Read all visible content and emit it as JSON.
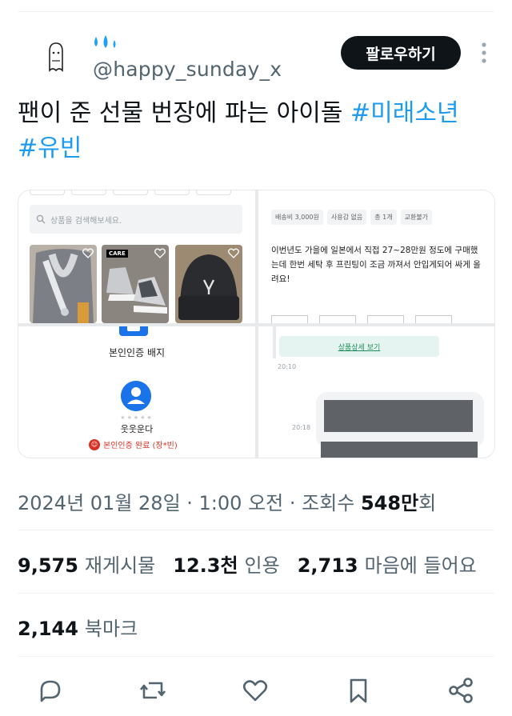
{
  "author": {
    "handle": "@happy_sunday_x",
    "avatar_icon": "ghost-doodle-icon",
    "header_icon": "water-drops-icon",
    "follow_label": "팔로우하기",
    "more_icon": "more-vertical-icon"
  },
  "tweet": {
    "text": "팬이 준 선물 번장에 파는 아이돌 ",
    "hashtags": [
      "#미래소년",
      "#유빈"
    ]
  },
  "media": {
    "search_placeholder": "상품을 검색해보세요.",
    "care_tag": "CARE",
    "chips": [
      "배송비 3,000원",
      "사용감 없음",
      "총 1개",
      "교환불가"
    ],
    "description": "이번년도 가을에 일본에서 직접 27~28만원 정도에 구매했는데 한번 세탁 후 프린팅이 조금 까져서 안입게되어 싸게 올려요!",
    "badge_title": "본인인증 배지",
    "nickname": "웃웃운다",
    "verified_text": "본인인증 완료 (장*빈)",
    "detail_button": "상품상세 보기",
    "time_1": "20:10",
    "time_2": "20:18"
  },
  "meta": {
    "datetime": "2024년 01월 28일 · 1:00 오전 · 조회수 ",
    "views_number": "548만",
    "views_suffix": "회"
  },
  "stats": {
    "retweets": "9,575",
    "retweets_label": "재게시물",
    "quotes": "12.3천",
    "quotes_label": "인용",
    "likes": "2,713",
    "likes_label": "마음에 들어요",
    "bookmarks": "2,144",
    "bookmarks_label": "북마크"
  },
  "actions": [
    "reply-icon",
    "retweet-icon",
    "like-icon",
    "bookmark-icon",
    "share-icon"
  ],
  "colors": {
    "accent": "#1d9bf0",
    "text": "#0f1419",
    "muted": "#536471",
    "button": "#0f1419"
  }
}
